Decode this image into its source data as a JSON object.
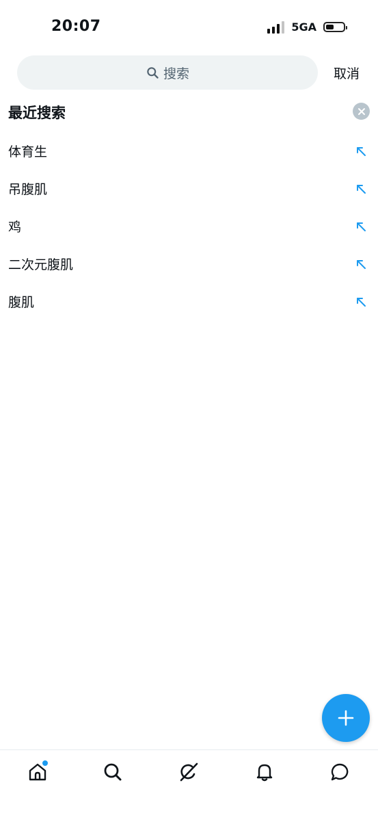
{
  "status_bar": {
    "time": "20:07",
    "network": "5GA",
    "battery_level_pct": 45
  },
  "search": {
    "placeholder": "搜索",
    "cancel_label": "取消"
  },
  "recent": {
    "title": "最近搜索",
    "items": [
      {
        "label": "体育生"
      },
      {
        "label": "吊腹肌"
      },
      {
        "label": "鸡"
      },
      {
        "label": "二次元腹肌"
      },
      {
        "label": "腹肌"
      }
    ]
  },
  "colors": {
    "accent": "#1d9bf0",
    "search_bg": "#eff3f4",
    "secondary_text": "#536471",
    "clear_button": "#b8c4cc"
  },
  "icons": {
    "search": "search-icon",
    "clear_all": "close-icon",
    "fill_arrow": "arrow-up-left-icon",
    "compose": "plus-icon",
    "tabs": [
      "home-icon",
      "search-icon",
      "grok-icon",
      "bell-icon",
      "message-icon"
    ]
  }
}
